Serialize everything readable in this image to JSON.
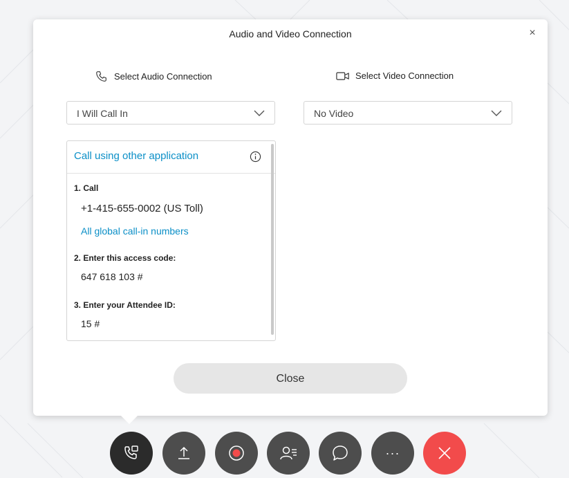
{
  "dialog": {
    "title": "Audio and Video Connection",
    "close_symbol": "×"
  },
  "audio": {
    "label": "Select Audio Connection",
    "icon": "phone-icon",
    "selected": "I Will Call In"
  },
  "video": {
    "label": "Select Video Connection",
    "icon": "video-camera-icon",
    "selected": "No Video"
  },
  "call_panel": {
    "header_link": "Call using other application",
    "steps": [
      {
        "label": "1. Call",
        "value": "+1-415-655-0002 (US Toll)",
        "link": "All global call-in numbers"
      },
      {
        "label": "2. Enter this access code:",
        "value": "647 618 103 #"
      },
      {
        "label": "3. Enter your Attendee ID:",
        "value": "15 #"
      }
    ]
  },
  "close_button": "Close",
  "colors": {
    "accent": "#0b8fc7",
    "toolbar_button": "#4d4d4d",
    "active_button": "#2b2b2b",
    "end_call": "#f24b4b"
  },
  "toolbar": {
    "buttons": [
      {
        "name": "audio-connection-button",
        "icon": "phone-settings-icon"
      },
      {
        "name": "share-button",
        "icon": "upload-icon"
      },
      {
        "name": "record-button",
        "icon": "record-icon"
      },
      {
        "name": "participants-button",
        "icon": "participants-icon"
      },
      {
        "name": "chat-button",
        "icon": "chat-icon"
      },
      {
        "name": "more-button",
        "icon": "more-icon",
        "text": "···"
      },
      {
        "name": "end-call-button",
        "icon": "close-icon"
      }
    ]
  }
}
